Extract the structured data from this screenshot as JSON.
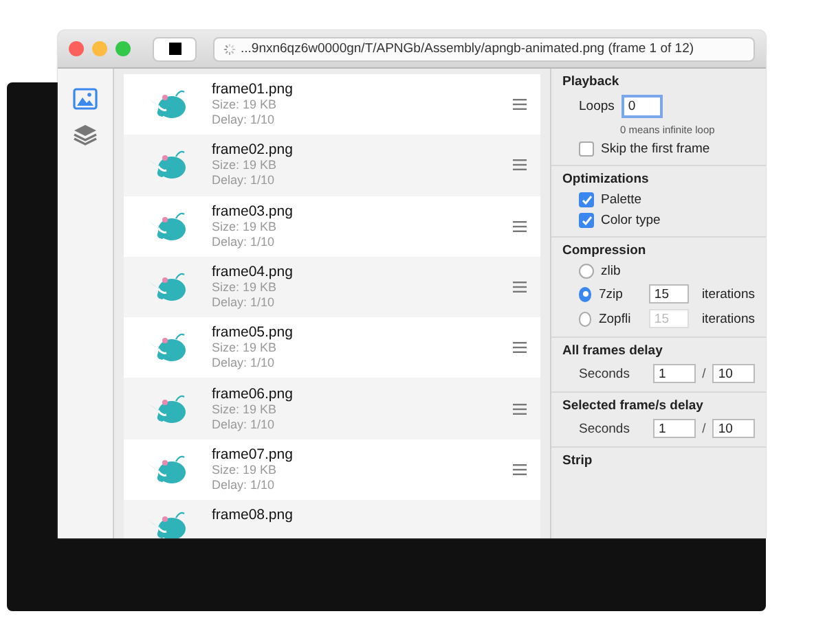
{
  "window": {
    "title": "...9nxn6qz6w0000gn/T/APNGb/Assembly/apngb-animated.png (frame 1 of 12)"
  },
  "sidebar": {
    "items": [
      {
        "kind": "image",
        "selected": true
      },
      {
        "kind": "layers",
        "selected": false
      }
    ]
  },
  "frames": [
    {
      "name": "frame01.png",
      "size": "Size: 19 KB",
      "delay": "Delay: 1/10"
    },
    {
      "name": "frame02.png",
      "size": "Size: 19 KB",
      "delay": "Delay: 1/10"
    },
    {
      "name": "frame03.png",
      "size": "Size: 19 KB",
      "delay": "Delay: 1/10"
    },
    {
      "name": "frame04.png",
      "size": "Size: 19 KB",
      "delay": "Delay: 1/10"
    },
    {
      "name": "frame05.png",
      "size": "Size: 19 KB",
      "delay": "Delay: 1/10"
    },
    {
      "name": "frame06.png",
      "size": "Size: 19 KB",
      "delay": "Delay: 1/10"
    },
    {
      "name": "frame07.png",
      "size": "Size: 19 KB",
      "delay": "Delay: 1/10"
    },
    {
      "name": "frame08.png"
    }
  ],
  "playback": {
    "title": "Playback",
    "loops_label": "Loops",
    "loops_value": "0",
    "loops_hint": "0 means infinite loop",
    "skip_first": {
      "label": "Skip the first frame",
      "checked": false
    }
  },
  "optimizations": {
    "title": "Optimizations",
    "options": [
      {
        "label": "Palette",
        "checked": true
      },
      {
        "label": "Color type",
        "checked": true
      }
    ]
  },
  "compression": {
    "title": "Compression",
    "options": [
      {
        "label": "zlib",
        "selected": false
      },
      {
        "label": "7zip",
        "selected": true,
        "iterations": "15",
        "iterations_label": "iterations",
        "disabled": false
      },
      {
        "label": "Zopfli",
        "selected": false,
        "iterations": "15",
        "iterations_label": "iterations",
        "disabled": true
      }
    ]
  },
  "all_frames_delay": {
    "title": "All frames delay",
    "label": "Seconds",
    "numerator": "1",
    "separator": "/",
    "denominator": "10"
  },
  "selected_delay": {
    "title": "Selected frame/s delay",
    "label": "Seconds",
    "numerator": "1",
    "separator": "/",
    "denominator": "10"
  },
  "strip": {
    "title": "Strip"
  }
}
